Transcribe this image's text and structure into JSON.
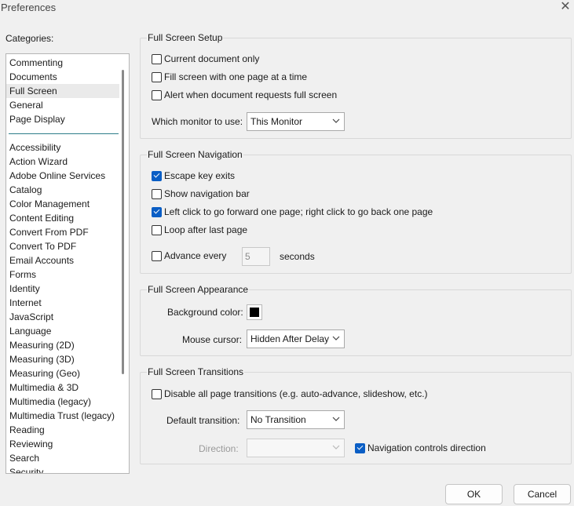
{
  "window": {
    "title": "Preferences",
    "close_glyph": "✕"
  },
  "categories": {
    "label": "Categories:",
    "top": [
      "Commenting",
      "Documents",
      "Full Screen",
      "General",
      "Page Display"
    ],
    "bottom": [
      "Accessibility",
      "Action Wizard",
      "Adobe Online Services",
      "Catalog",
      "Color Management",
      "Content Editing",
      "Convert From PDF",
      "Convert To PDF",
      "Email Accounts",
      "Forms",
      "Identity",
      "Internet",
      "JavaScript",
      "Language",
      "Measuring (2D)",
      "Measuring (3D)",
      "Measuring (Geo)",
      "Multimedia & 3D",
      "Multimedia (legacy)",
      "Multimedia Trust (legacy)",
      "Reading",
      "Reviewing",
      "Search",
      "Security"
    ],
    "selected": "Full Screen"
  },
  "setup": {
    "title": "Full Screen Setup",
    "current_doc": {
      "label": "Current document only",
      "checked": false
    },
    "fill_screen": {
      "label": "Fill screen with one page at a time",
      "checked": false
    },
    "alert": {
      "label": "Alert when document requests full screen",
      "checked": false
    },
    "monitor_label": "Which monitor to use:",
    "monitor_value": "This Monitor"
  },
  "navigation": {
    "title": "Full Screen Navigation",
    "escape": {
      "label": "Escape key exits",
      "checked": true
    },
    "navbar": {
      "label": "Show navigation bar",
      "checked": false
    },
    "leftclick": {
      "label": "Left click to go forward one page; right click to go back one page",
      "checked": true
    },
    "loop": {
      "label": "Loop after last page",
      "checked": false
    },
    "advance": {
      "label": "Advance every",
      "checked": false
    },
    "advance_value": "5",
    "seconds_label": "seconds"
  },
  "appearance": {
    "title": "Full Screen Appearance",
    "bg_label": "Background color:",
    "bg_color": "#000000",
    "cursor_label": "Mouse cursor:",
    "cursor_value": "Hidden After Delay"
  },
  "transitions": {
    "title": "Full Screen Transitions",
    "disable": {
      "label": "Disable all page transitions (e.g. auto-advance, slideshow, etc.)",
      "checked": false
    },
    "default_label": "Default transition:",
    "default_value": "No Transition",
    "direction_label": "Direction:",
    "direction_value": "",
    "nav_controls": {
      "label": "Navigation controls direction",
      "checked": true
    }
  },
  "buttons": {
    "ok": "OK",
    "cancel": "Cancel"
  },
  "colors": {
    "accent": "#0a5ec5",
    "separator": "#2d7d8a"
  }
}
